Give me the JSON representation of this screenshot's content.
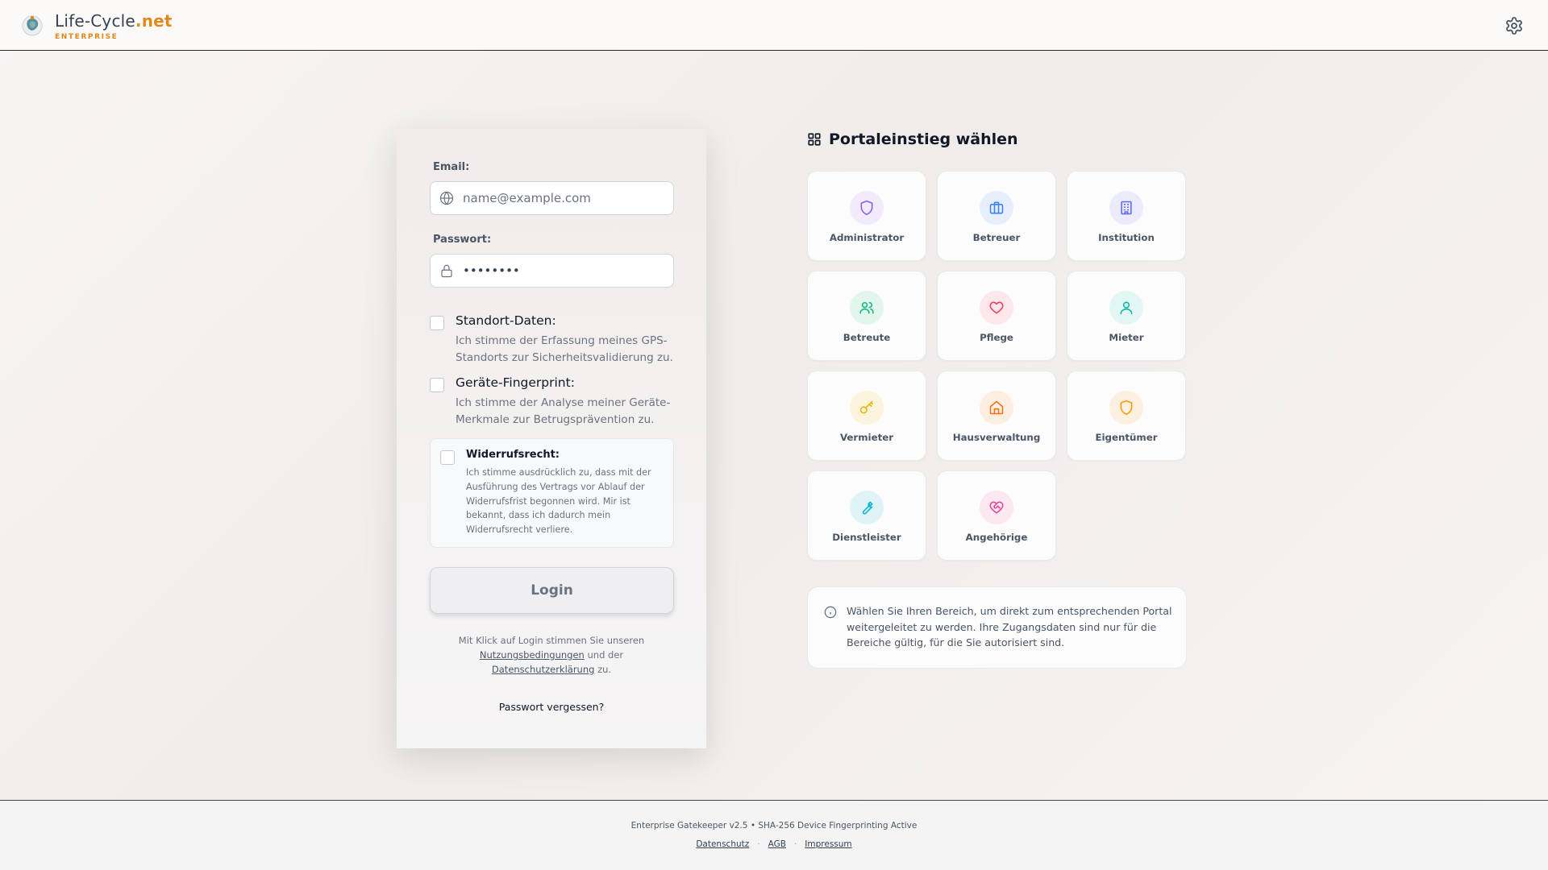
{
  "header": {
    "brand_prefix": "Life-Cycle",
    "brand_suffix": ".net",
    "brand_sub": "ENTERPRISE",
    "settings_icon": "gear-icon"
  },
  "login": {
    "email_label": "Email:",
    "email_placeholder": "name@example.com",
    "password_label": "Passwort:",
    "password_value": "••••••••",
    "location_title": "Standort-Daten:",
    "location_desc": "Ich stimme der Erfassung meines GPS-Standorts zur Sicherheitsvalidierung zu.",
    "fingerprint_title": "Geräte-Fingerprint:",
    "fingerprint_desc": "Ich stimme der Analyse meiner Geräte-Merkmale zur Betrugsprävention zu.",
    "widerruf_title": "Widerrufsrecht:",
    "widerruf_desc": "Ich stimme ausdrücklich zu, dass mit der Ausführung des Vertrags vor Ablauf der Widerrufsfrist begonnen wird. Mir ist bekannt, dass ich dadurch mein Widerrufsrecht verliere.",
    "login_button": "Login",
    "terms_pre": "Mit Klick auf Login stimmen Sie unseren",
    "terms_link1": "Nutzungsbedingungen",
    "terms_mid": "und der",
    "terms_link2": "Datenschutzerklärung",
    "terms_post": "zu.",
    "forgot": "Passwort vergessen?"
  },
  "portal": {
    "title": "Portaleinstieg wählen",
    "tiles": [
      {
        "label": "Administrator",
        "icon": "shield-icon",
        "color": "#8b5cf6",
        "bg": "#f1ebfc"
      },
      {
        "label": "Betreuer",
        "icon": "briefcase-icon",
        "color": "#3b82f6",
        "bg": "#e8effc"
      },
      {
        "label": "Institution",
        "icon": "building-icon",
        "color": "#6366f1",
        "bg": "#ebebfb"
      },
      {
        "label": "Betreute",
        "icon": "users-icon",
        "color": "#10b981",
        "bg": "#e3f6ee"
      },
      {
        "label": "Pflege",
        "icon": "heart-icon",
        "color": "#f43f5e",
        "bg": "#fde9ec"
      },
      {
        "label": "Mieter",
        "icon": "user-icon",
        "color": "#14b8a6",
        "bg": "#e2f6f3"
      },
      {
        "label": "Vermieter",
        "icon": "key-icon",
        "color": "#eab308",
        "bg": "#fcf4dc"
      },
      {
        "label": "Hausverwaltung",
        "icon": "home-icon",
        "color": "#f97316",
        "bg": "#fdeee2"
      },
      {
        "label": "Eigentümer",
        "icon": "shield-outline-icon",
        "color": "#f59e0b",
        "bg": "#fcf0e0"
      },
      {
        "label": "Dienstleister",
        "icon": "wrench-icon",
        "color": "#06b6d4",
        "bg": "#e0f4f8"
      },
      {
        "label": "Angehörige",
        "icon": "heart-handshake-icon",
        "color": "#ec4899",
        "bg": "#fce8f1"
      }
    ],
    "info": "Wählen Sie Ihren Bereich, um direkt zum entsprechenden Portal weitergeleitet zu werden. Ihre Zugangsdaten sind nur für die Bereiche gültig, für die Sie autorisiert sind."
  },
  "footer": {
    "text": "Enterprise Gatekeeper v2.5 • SHA-256 Device Fingerprinting Active",
    "links": [
      "Datenschutz",
      "AGB",
      "Impressum"
    ],
    "separator": "·"
  }
}
